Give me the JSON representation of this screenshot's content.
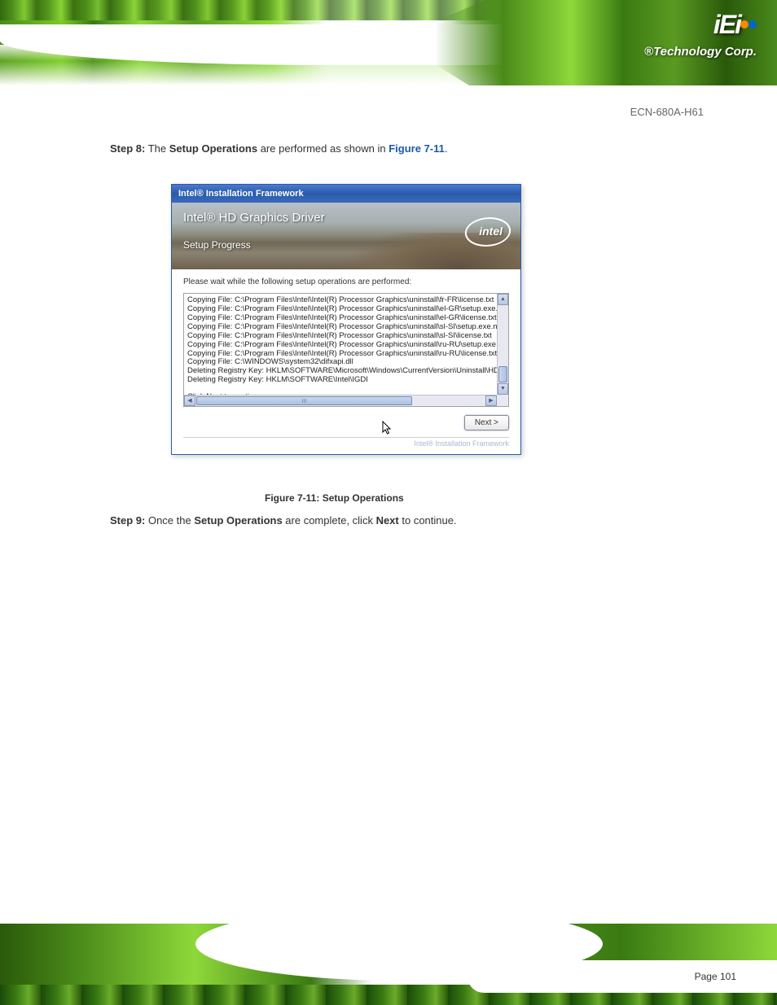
{
  "branding": {
    "logo": "iEi",
    "tagline": "®Technology Corp."
  },
  "doc": {
    "header_right": "ECN-680A-H61",
    "step8": "Step 8: The Setup Operations are performed as shown in Figure 7-11.",
    "step9": "Step 9: Once the Setup Operations are complete, click Next to continue.",
    "caption": "Figure 7-11: Setup Operations",
    "page": "Page 101"
  },
  "installer": {
    "titlebar": "Intel® Installation Framework",
    "header_title": "Intel® HD Graphics Driver",
    "header_sub": "Setup Progress",
    "intel": "intel",
    "wait_text": "Please wait while the following setup operations are performed:",
    "log_lines": [
      "Copying File: C:\\Program Files\\Intel\\Intel(R) Processor Graphics\\uninstall\\fr-FR\\license.txt",
      "Copying File: C:\\Program Files\\Intel\\Intel(R) Processor Graphics\\uninstall\\el-GR\\setup.exe.mui",
      "Copying File: C:\\Program Files\\Intel\\Intel(R) Processor Graphics\\uninstall\\el-GR\\license.txt",
      "Copying File: C:\\Program Files\\Intel\\Intel(R) Processor Graphics\\uninstall\\sl-SI\\setup.exe.mui",
      "Copying File: C:\\Program Files\\Intel\\Intel(R) Processor Graphics\\uninstall\\sl-SI\\license.txt",
      "Copying File: C:\\Program Files\\Intel\\Intel(R) Processor Graphics\\uninstall\\ru-RU\\setup.exe.mui",
      "Copying File: C:\\Program Files\\Intel\\Intel(R) Processor Graphics\\uninstall\\ru-RU\\license.txt",
      "Copying File: C:\\WINDOWS\\system32\\difxapi.dll",
      "Deleting Registry Key: HKLM\\SOFTWARE\\Microsoft\\Windows\\CurrentVersion\\Uninstall\\HDMI",
      "Deleting Registry Key: HKLM\\SOFTWARE\\Intel\\IGDI"
    ],
    "log_next": "Click Next to continue.",
    "next_button": "Next >",
    "footer": "Intel® Installation Framework"
  }
}
